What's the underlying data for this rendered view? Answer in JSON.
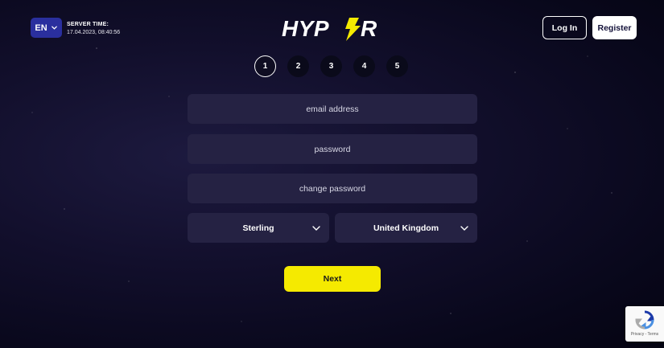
{
  "header": {
    "language": "EN",
    "server_time_label": "SERVER TIME:",
    "server_time_value": "17.04.2023, 08:40:56",
    "brand": "HYPER",
    "login_label": "Log In",
    "register_label": "Register"
  },
  "steps": [
    "1",
    "2",
    "3",
    "4",
    "5"
  ],
  "active_step": "1",
  "form": {
    "email_placeholder": "email address",
    "password_placeholder": "password",
    "confirm_password_placeholder": "change password",
    "currency": "Sterling",
    "country": "United Kingdom",
    "next_label": "Next"
  },
  "recaptcha": {
    "footer_text": "Privacy - Terms"
  },
  "colors": {
    "accent_yellow": "#f5ea00",
    "field_bg": "#252243",
    "lang_bg": "#2a2f9e",
    "page_bg": "#0c0a22"
  }
}
